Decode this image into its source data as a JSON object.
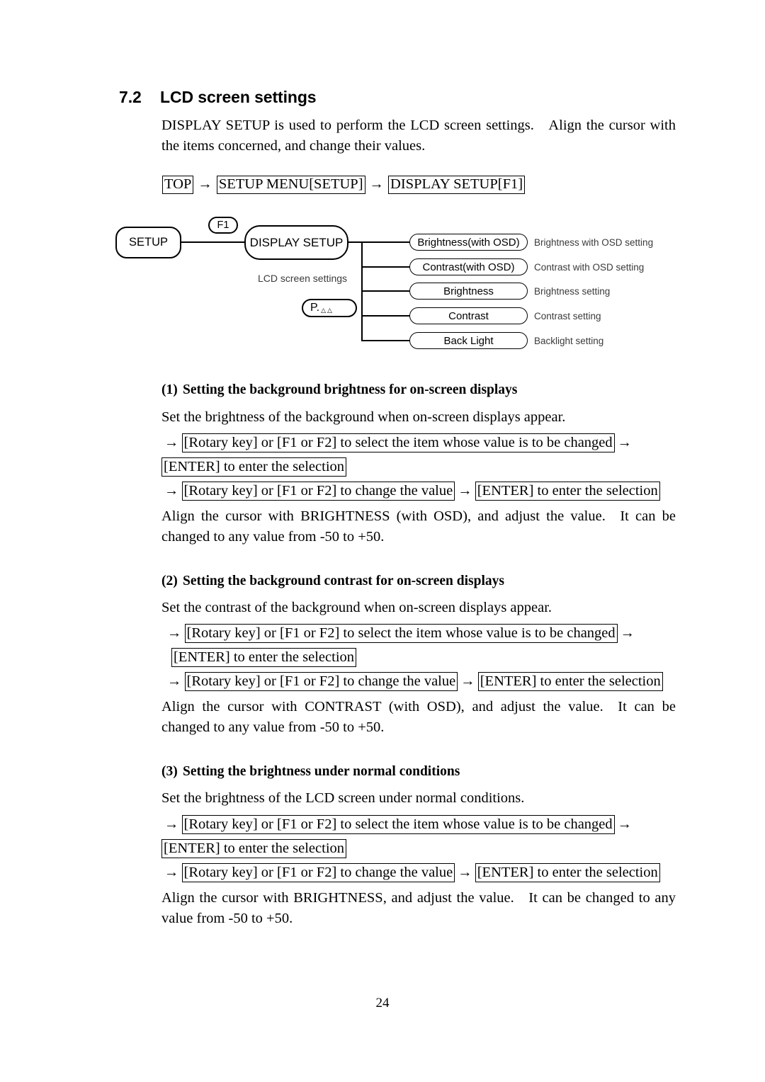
{
  "section": {
    "number": "7.2",
    "title": "LCD screen settings",
    "intro": "DISPLAY SETUP is used to perform the LCD screen settings. Align the cursor with the items concerned, and change their values."
  },
  "breadcrumb": {
    "items": [
      "TOP",
      "SETUP MENU[SETUP]",
      "DISPLAY SETUP[F1]"
    ],
    "arrow": "→"
  },
  "diagram": {
    "setup_node": "SETUP",
    "f1_badge": "F1",
    "display_node": "DISPLAY SETUP",
    "caption": "LCD screen settings",
    "page_ref": "P.",
    "page_ref_marks": "△△",
    "items": [
      {
        "label": "Brightness(with OSD)",
        "desc": "Brightness with OSD setting"
      },
      {
        "label": "Contrast(with OSD)",
        "desc": "Contrast with OSD setting"
      },
      {
        "label": "Brightness",
        "desc": "Brightness setting"
      },
      {
        "label": "Contrast",
        "desc": "Contrast setting"
      },
      {
        "label": "Back Light",
        "desc": "Backlight setting"
      }
    ]
  },
  "sections": [
    {
      "number": "(1)",
      "heading": "Setting the background brightness for on-screen displays",
      "lead": "Set the brightness of the background when on-screen displays appear.",
      "step1_box": "[Rotary key] or [F1 or F2] to select the item whose value is to be changed",
      "step2_box": "[ENTER] to enter the selection",
      "step3_box": "[Rotary key] or [F1 or F2] to change the value",
      "step4_box": "[ENTER] to enter the selection",
      "closing": "Align the cursor with BRIGHTNESS (with OSD), and adjust the value. It can be changed to any value from -50 to +50."
    },
    {
      "number": "(2)",
      "heading": "Setting the background contrast for on-screen displays",
      "lead": "Set the contrast of the background when on-screen displays appear.",
      "step1_box": "[Rotary key] or [F1 or F2] to select the item whose value is to be changed",
      "step2_box": "[ENTER] to enter the selection",
      "step3_box": "[Rotary key] or [F1 or F2] to change the value",
      "step4_box": "[ENTER] to enter the selection",
      "closing": "Align the cursor with CONTRAST (with OSD), and adjust the value. It can be changed to any value from -50 to +50."
    },
    {
      "number": "(3)",
      "heading": "Setting the brightness under normal conditions",
      "lead": "Set the brightness of the LCD screen under normal conditions.",
      "step1_box": "[Rotary key] or [F1 or F2] to select the item whose value is to be changed",
      "step2_box": "[ENTER] to enter the selection",
      "step3_box": "[Rotary key] or [F1 or F2] to change the value",
      "step4_box": "[ENTER] to enter the selection",
      "closing": "Align the cursor with BRIGHTNESS, and adjust the value. It can be changed to any value from -50 to +50."
    }
  ],
  "arrow": "→",
  "footer": {
    "page_number": "24"
  }
}
